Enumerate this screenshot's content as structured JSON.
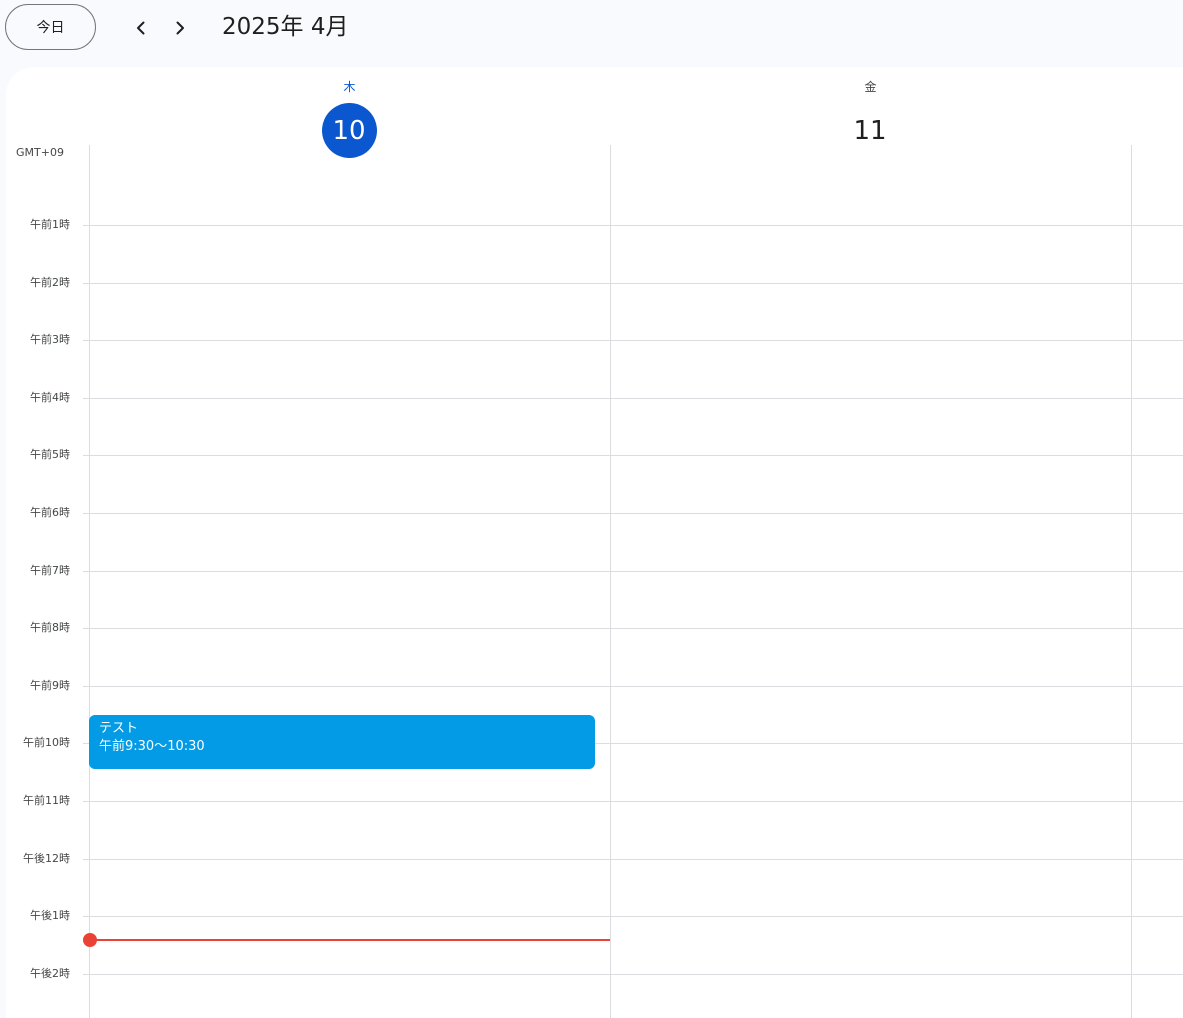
{
  "toolbar": {
    "today_label": "今日",
    "title": "2025年 4月"
  },
  "timezone_label": "GMT+09",
  "days": [
    {
      "weekday": "木",
      "date": "10",
      "is_today": true
    },
    {
      "weekday": "金",
      "date": "11",
      "is_today": false
    }
  ],
  "hours": [
    "午前1時",
    "午前2時",
    "午前3時",
    "午前4時",
    "午前5時",
    "午前6時",
    "午前7時",
    "午前8時",
    "午前9時",
    "午前10時",
    "午前11時",
    "午後12時",
    "午後1時",
    "午後2時"
  ],
  "event": {
    "title": "テスト",
    "time": "午前9:30〜10:30",
    "color": "#039be5"
  },
  "icons": {
    "prev": "chevron-left-icon",
    "next": "chevron-right-icon"
  },
  "colors": {
    "today_accent": "#0b57d0",
    "now_indicator": "#ea4335"
  }
}
